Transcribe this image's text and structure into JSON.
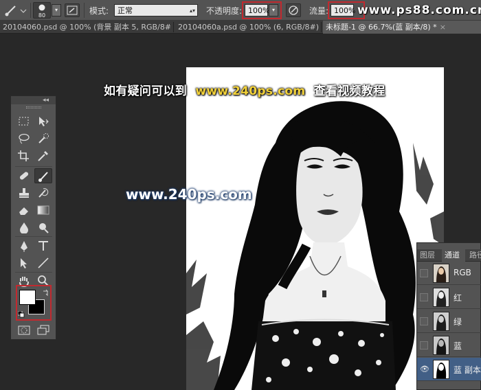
{
  "options_bar": {
    "brush_size": "80",
    "mode_label": "模式:",
    "mode_value": "正常",
    "opacity_label": "不透明度:",
    "opacity_value": "100%",
    "flow_label": "流量:",
    "flow_value": "100%"
  },
  "document_tabs": [
    {
      "label": "20104060.psd @ 100% (背景 副本 5, RGB/8#) *",
      "close": "×"
    },
    {
      "label": "20104060a.psd @ 100% (6, RGB/8#) *",
      "close": "×"
    },
    {
      "label": "未标题-1 @ 66.7%(蓝 副本/8) *",
      "close": "×"
    }
  ],
  "toolbox": {
    "collapse_glyph": "◂◂"
  },
  "watermarks": {
    "banner_cn_before": "如有疑问可以到",
    "banner_url": "www.240ps.com",
    "banner_cn_after": "查看视频教程",
    "center": "www.240ps.com",
    "corner": "www.ps88.com.cn"
  },
  "channels_panel": {
    "tabs": [
      "图层",
      "通道",
      "路径"
    ],
    "active_tab": "通道",
    "channels": [
      {
        "name": "RGB",
        "visible": false,
        "selected": false
      },
      {
        "name": "红",
        "visible": false,
        "selected": false
      },
      {
        "name": "绿",
        "visible": false,
        "selected": false
      },
      {
        "name": "蓝",
        "visible": false,
        "selected": false
      },
      {
        "name": "蓝 副本",
        "visible": true,
        "selected": true
      }
    ]
  },
  "colors": {
    "highlight_red": "#c2292f",
    "foreground": "#ffffff",
    "background": "#000000",
    "selected_row": "#425f86",
    "banner_url": "#f3d23a"
  }
}
